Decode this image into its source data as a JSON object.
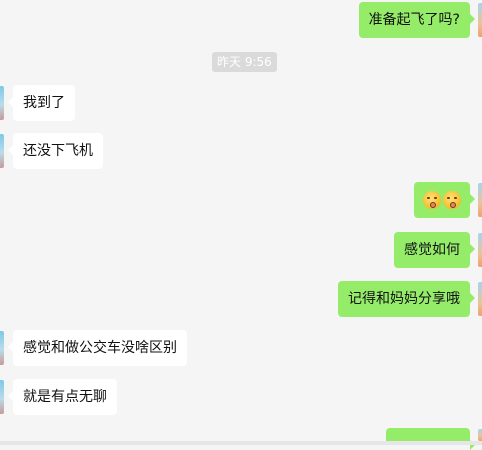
{
  "timestamp": "昨天 9:56",
  "messages": [
    {
      "side": "out",
      "text": "准备起飞了吗?"
    },
    {
      "side": "in",
      "text": "我到了"
    },
    {
      "side": "in",
      "text": "还没下飞机"
    },
    {
      "side": "out",
      "emoji": [
        "kissing-face-emoji",
        "kissing-face-emoji"
      ]
    },
    {
      "side": "out",
      "text": "感觉如何"
    },
    {
      "side": "out",
      "text": "记得和妈妈分享哦"
    },
    {
      "side": "in",
      "text": "感觉和做公交车没啥区别"
    },
    {
      "side": "in",
      "text": "就是有点无聊"
    },
    {
      "side": "out",
      "text": ""
    }
  ],
  "colors": {
    "background": "#f5f5f5",
    "outgoing_bubble": "#95ec69",
    "incoming_bubble": "#ffffff",
    "timestamp_bg": "#dadada"
  }
}
